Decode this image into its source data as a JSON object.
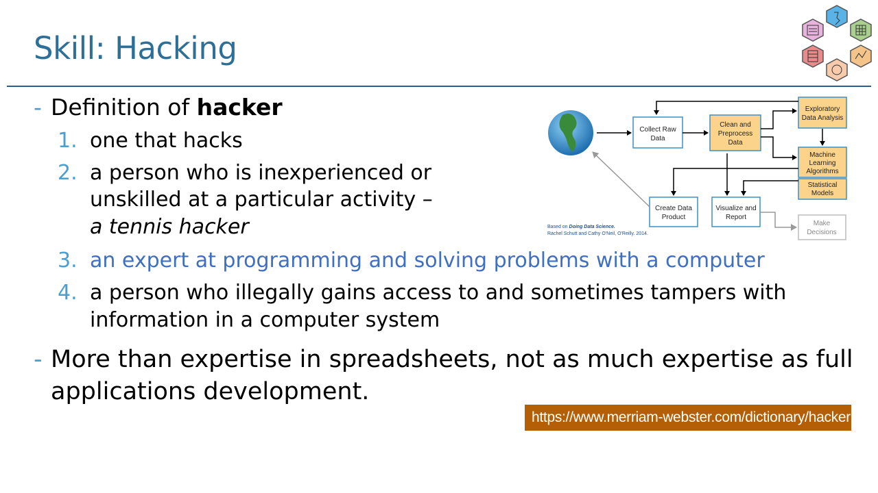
{
  "slide": {
    "title": "Skill: Hacking",
    "bullet1": {
      "dash": "-",
      "text_pre": "Definition of ",
      "text_bold": "hacker"
    },
    "definitions": [
      {
        "num": "1.",
        "line1": "one that hacks"
      },
      {
        "num": "2.",
        "line1": "a person who is inexperienced or",
        "line2": "unskilled at a particular activity –",
        "line3": "a tennis hacker"
      },
      {
        "num": "3.",
        "line1": "an expert at programming and solving problems with a computer"
      },
      {
        "num": "4.",
        "line1": "a person who illegally gains access to and sometimes tampers with",
        "line2": "information in a computer system"
      }
    ],
    "bullet2": {
      "dash": "-",
      "line1": "More than expertise in spreadsheets, not as much expertise as full",
      "line2": "applications development."
    },
    "url_label": "https://www.merriam-webster.com/dictionary/hacker"
  },
  "diagram": {
    "boxes": {
      "collect": [
        "Collect Raw",
        "Data"
      ],
      "clean": [
        "Clean and",
        "Preprocess",
        "Data"
      ],
      "eda": [
        "Exploratory",
        "Data Analysis"
      ],
      "ml": [
        "Machine",
        "Learning",
        "Algorithms"
      ],
      "stats": [
        "Statistical",
        "Models"
      ],
      "create": [
        "Create Data",
        "Product"
      ],
      "viz": [
        "Visualize and",
        "Report"
      ],
      "decisions": [
        "Make",
        "Decisions"
      ]
    },
    "credit_line1_pre": "Based on ",
    "credit_line1_book": "Doing Data Science.",
    "credit_line2": "Rachel Schutt and Cathy O'Neil, O'Reilly. 2014."
  },
  "colors": {
    "title": "#2e6f98",
    "accent": "#4a9fd0",
    "highlight": "#3f6fc0",
    "url_bg": "#b45f06",
    "box_fill": "#fbd38b"
  }
}
